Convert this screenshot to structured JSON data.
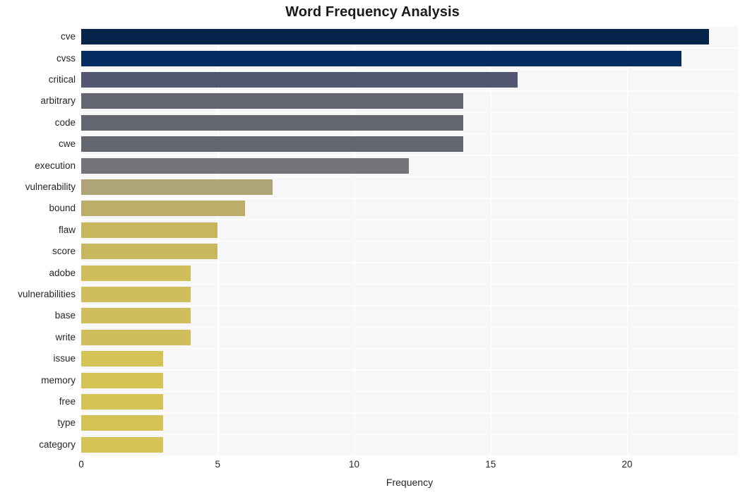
{
  "chart_data": {
    "type": "bar",
    "orientation": "horizontal",
    "title": "Word Frequency Analysis",
    "xlabel": "Frequency",
    "ylabel": "",
    "xlim": [
      0,
      24
    ],
    "ylim": [
      0,
      20
    ],
    "grid": true,
    "legend": "none",
    "xticks": [
      0,
      5,
      10,
      15,
      20
    ],
    "xtick_labels": [
      "0",
      "5",
      "10",
      "15",
      "20"
    ],
    "categories": [
      "cve",
      "cvss",
      "critical",
      "arbitrary",
      "code",
      "cwe",
      "execution",
      "vulnerability",
      "bound",
      "flaw",
      "score",
      "adobe",
      "vulnerabilities",
      "base",
      "write",
      "issue",
      "memory",
      "free",
      "type",
      "category"
    ],
    "values": [
      23,
      22,
      16,
      14,
      14,
      14,
      12,
      7,
      6,
      5,
      5,
      4,
      4,
      4,
      4,
      3,
      3,
      3,
      3,
      3
    ],
    "bar_colors": [
      "#06234b",
      "#062d62",
      "#525670",
      "#63656f",
      "#64666f",
      "#64666f",
      "#73747a",
      "#aea478",
      "#bcae6a",
      "#c7b85f",
      "#c7b85f",
      "#cfbe5b",
      "#cfbe5b",
      "#cfbe5b",
      "#cfbe5b",
      "#d5c455",
      "#d5c455",
      "#d5c455",
      "#d5c455",
      "#d5c455"
    ],
    "plot_background": "#f7f7f7",
    "gridline_color": "#ffffff",
    "figure_background": "#ffffff",
    "text_color": "#262626"
  }
}
